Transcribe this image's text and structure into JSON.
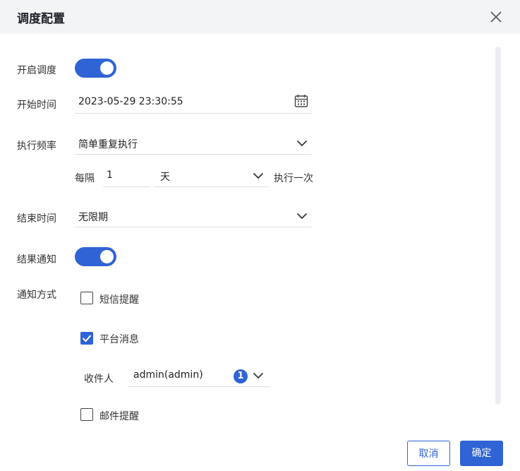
{
  "dialog": {
    "title": "调度配置"
  },
  "form": {
    "enable_schedule": {
      "label": "开启调度",
      "on": true
    },
    "start_time": {
      "label": "开始时间",
      "value": "2023-05-29 23:30:55",
      "icon": "calendar-icon"
    },
    "frequency": {
      "label": "执行频率",
      "value": "简单重复执行"
    },
    "interval": {
      "prefix": "每隔",
      "count": "1",
      "unit": "天",
      "suffix": "执行一次"
    },
    "end_time": {
      "label": "结束时间",
      "value": "无限期"
    },
    "result_notify": {
      "label": "结果通知",
      "on": true
    },
    "notify_method": {
      "label": "通知方式",
      "options": [
        {
          "label": "短信提醒",
          "checked": false
        },
        {
          "label": "平台消息",
          "checked": true
        },
        {
          "label": "邮件提醒",
          "checked": false
        }
      ]
    },
    "recipient": {
      "label": "收件人",
      "value": "admin(admin)",
      "count": "1"
    }
  },
  "footer": {
    "cancel": "取消",
    "confirm": "确定"
  },
  "colors": {
    "accent": "#2f63d6",
    "header_bg": "#f3f4f6",
    "border": "#dcdfe6"
  }
}
